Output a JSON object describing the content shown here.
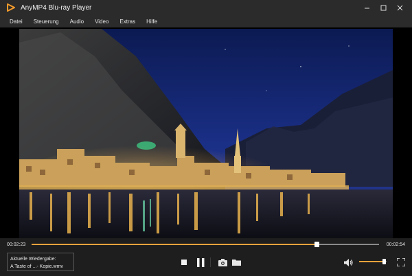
{
  "window": {
    "title": "AnyMP4 Blu-ray Player",
    "brand_color": "#f39a2b",
    "controls": [
      "minimize-icon",
      "maximize-icon",
      "close-icon"
    ]
  },
  "menu": {
    "items": [
      "Datei",
      "Steuerung",
      "Audio",
      "Video",
      "Extras",
      "Hilfe"
    ]
  },
  "playback": {
    "current_time": "00:02:23",
    "total_time": "00:02:54",
    "progress": 0.82,
    "accent_color": "#f0a23a"
  },
  "now_playing": {
    "label": "Aktuelle Wiedergabe:",
    "file": "A Taste of ...- Kopie.wmv"
  },
  "controls": {
    "icons": [
      "stop-icon",
      "pause-icon",
      "snapshot-icon",
      "folder-icon",
      "volume-icon",
      "fullscreen-icon"
    ],
    "volume": 0.9
  }
}
